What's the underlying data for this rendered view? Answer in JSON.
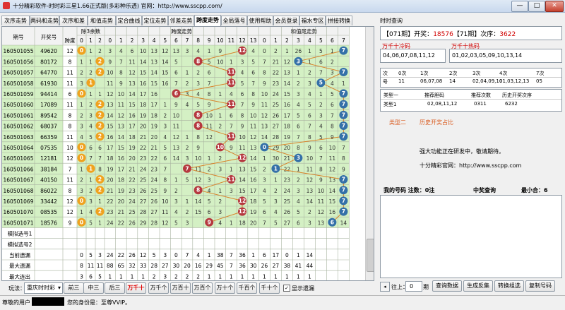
{
  "window": {
    "title": "十分精彩软件-时时彩三星1.66正式版(多彩种乐透) 官网：http://www.sscpp.com/",
    "minimize_label": "—",
    "maximize_label": "□",
    "close_label": "✕"
  },
  "tabs": [
    "次序走势",
    "两码和走势",
    "次序和差",
    "和值走势",
    "定合曲线",
    "定位走势",
    "邻差走势",
    "跨度走势",
    "全局落号",
    "使用帮助",
    "会员登录",
    "福水专区",
    "拼接转换"
  ],
  "active_tab": 7,
  "grid": {
    "header_top": {
      "period": "期号",
      "number": "开奖号",
      "rem3": "除3余数",
      "span": "跨度走势",
      "sum_tail": "和值尾走势"
    },
    "header_span_label": "跨度",
    "rem3_cols": [
      "0",
      "1",
      "2"
    ],
    "span_cols": [
      "0",
      "1",
      "2",
      "3",
      "4",
      "5",
      "6",
      "7",
      "8",
      "9",
      "10",
      "11",
      "12",
      "13"
    ],
    "sumtail_cols": [
      "0",
      "1",
      "2",
      "3",
      "4",
      "5",
      "6",
      "7"
    ],
    "rows": [
      {
        "period": "160501055",
        "number": "49620",
        "span": "12",
        "rem": [
          0,
          1,
          2
        ],
        "spans": [
          3,
          4,
          6,
          10,
          13,
          12,
          13,
          3,
          4,
          1,
          9,
          null,
          2,
          4
        ],
        "tail": [
          0,
          2,
          1,
          26,
          1,
          5,
          1,
          null
        ]
      },
      {
        "period": "160501056",
        "number": "80172",
        "span": "8",
        "rem": [
          1,
          1,
          null
        ],
        "spans": [
          9,
          7,
          11,
          14,
          13,
          14,
          5,
          null,
          1,
          5,
          10,
          1,
          3,
          5
        ],
        "tail": [
          7,
          21,
          12,
          null,
          1,
          6,
          2,
          null
        ]
      },
      {
        "period": "160501057",
        "number": "64770",
        "span": "11",
        "rem": [
          2,
          2,
          null
        ],
        "spans": [
          10,
          8,
          12,
          15,
          14,
          15,
          6,
          1,
          2,
          6,
          null,
          2,
          4,
          6
        ],
        "tail": [
          8,
          22,
          13,
          1,
          2,
          7,
          3,
          null
        ]
      },
      {
        "period": "160501058",
        "number": "61930",
        "span": "11",
        "rem": [
          3,
          3,
          null
        ],
        "spans": [
          11,
          9,
          13,
          16,
          15,
          16,
          7,
          2,
          3,
          7,
          null,
          3,
          5,
          7
        ],
        "tail": [
          9,
          23,
          14,
          2,
          3,
          null,
          4,
          1
        ]
      },
      {
        "period": "160501059",
        "number": "94414",
        "span": "6",
        "rem": [
          null,
          1,
          1
        ],
        "spans": [
          12,
          10,
          14,
          17,
          16,
          null,
          8,
          3,
          4,
          8,
          1,
          4,
          6,
          8
        ],
        "tail": [
          10,
          24,
          15,
          3,
          4,
          1,
          5,
          2
        ]
      },
      {
        "period": "160501060",
        "number": "17089",
        "span": "11",
        "rem": [
          1,
          2,
          2
        ],
        "spans": [
          13,
          11,
          15,
          18,
          17,
          1,
          9,
          4,
          5,
          9,
          null,
          5,
          7,
          9
        ],
        "tail": [
          11,
          25,
          16,
          4,
          5,
          2,
          6,
          3
        ]
      },
      {
        "period": "160501061",
        "number": "89542",
        "span": "8",
        "rem": [
          2,
          3,
          3
        ],
        "spans": [
          14,
          12,
          16,
          19,
          18,
          2,
          10,
          null,
          6,
          10,
          1,
          6,
          8,
          10
        ],
        "tail": [
          12,
          26,
          17,
          5,
          6,
          3,
          7,
          4
        ]
      },
      {
        "period": "160501062",
        "number": "68037",
        "span": "8",
        "rem": [
          3,
          4,
          4
        ],
        "spans": [
          15,
          13,
          17,
          20,
          19,
          3,
          11,
          null,
          7,
          11,
          2,
          7,
          9,
          11
        ],
        "tail": [
          13,
          27,
          18,
          6,
          7,
          4,
          8,
          5
        ]
      },
      {
        "period": "160501063",
        "number": "66359",
        "span": "11",
        "rem": [
          4,
          5,
          5
        ],
        "spans": [
          16,
          14,
          18,
          21,
          20,
          4,
          12,
          1,
          8,
          12,
          null,
          8,
          10,
          12
        ],
        "tail": [
          14,
          28,
          19,
          7,
          8,
          5,
          9,
          6
        ]
      },
      {
        "period": "160501064",
        "number": "07535",
        "span": "10",
        "rem": [
          5,
          6,
          6
        ],
        "spans": [
          17,
          15,
          19,
          22,
          21,
          5,
          13,
          2,
          9,
          null,
          1,
          9,
          11,
          13
        ],
        "tail": [
          null,
          29,
          20,
          8,
          9,
          6,
          10,
          7
        ]
      },
      {
        "period": "160501065",
        "number": "12181",
        "span": "12",
        "rem": [
          0,
          7,
          7
        ],
        "spans": [
          18,
          16,
          20,
          23,
          22,
          6,
          14,
          3,
          10,
          1,
          2,
          null,
          12,
          14
        ],
        "tail": [
          1,
          30,
          21,
          null,
          10,
          7,
          11,
          8
        ]
      },
      {
        "period": "160501066",
        "number": "38184",
        "span": "7",
        "rem": [
          1,
          null,
          8
        ],
        "spans": [
          19,
          17,
          21,
          24,
          23,
          7,
          null,
          4,
          11,
          2,
          3,
          1,
          13,
          15
        ],
        "tail": [
          2,
          null,
          22,
          1,
          11,
          8,
          12,
          9
        ]
      },
      {
        "period": "160501067",
        "number": "40150",
        "span": "11",
        "rem": [
          2,
          1,
          null
        ],
        "spans": [
          20,
          18,
          22,
          25,
          24,
          8,
          1,
          5,
          12,
          3,
          null,
          2,
          14,
          16
        ],
        "tail": [
          3,
          1,
          23,
          2,
          12,
          9,
          13,
          10
        ]
      },
      {
        "period": "160501068",
        "number": "86022",
        "span": "8",
        "rem": [
          3,
          2,
          null
        ],
        "spans": [
          21,
          19,
          23,
          26,
          25,
          9,
          2,
          null,
          13,
          4,
          1,
          3,
          15,
          17
        ],
        "tail": [
          4,
          2,
          24,
          3,
          13,
          10,
          14,
          11
        ]
      },
      {
        "period": "160501069",
        "number": "33442",
        "span": "12",
        "rem": [
          null,
          3,
          1
        ],
        "spans": [
          22,
          20,
          24,
          27,
          26,
          10,
          3,
          1,
          14,
          5,
          2,
          null,
          16,
          18
        ],
        "tail": [
          5,
          3,
          25,
          4,
          14,
          11,
          15,
          12
        ]
      },
      {
        "period": "160501070",
        "number": "08535",
        "span": "12",
        "rem": [
          1,
          4,
          null
        ],
        "spans": [
          23,
          21,
          25,
          28,
          27,
          11,
          4,
          2,
          15,
          6,
          3,
          null,
          17,
          19
        ],
        "tail": [
          6,
          4,
          26,
          5,
          2,
          12,
          16,
          13
        ]
      },
      {
        "period": "160501071",
        "number": "18576",
        "span": "9",
        "rem": [
          null,
          5,
          1
        ],
        "spans": [
          24,
          22,
          26,
          29,
          28,
          12,
          5,
          3,
          null,
          7,
          4,
          1,
          18,
          20
        ],
        "tail": [
          7,
          5,
          27,
          6,
          3,
          13,
          null,
          14
        ]
      }
    ],
    "hit_points": [
      {
        "row": 0,
        "rem": 0,
        "span": 12,
        "tail": 7
      },
      {
        "row": 1,
        "rem": 2,
        "span": 8,
        "tail": 3
      },
      {
        "row": 2,
        "rem": 2,
        "span": 11,
        "tail": 7
      },
      {
        "row": 3,
        "rem": 1,
        "span": 11,
        "tail": 5
      },
      {
        "row": 4,
        "rem": 0,
        "span": 6,
        "tail": 7
      },
      {
        "row": 5,
        "rem": 2,
        "span": 11,
        "tail": 7
      },
      {
        "row": 6,
        "rem": 2,
        "span": 8,
        "tail": 7
      },
      {
        "row": 7,
        "rem": 2,
        "span": 8,
        "tail": 7
      },
      {
        "row": 8,
        "rem": 2,
        "span": 11,
        "tail": 7
      },
      {
        "row": 9,
        "rem": 0,
        "span": 10,
        "tail": 0
      },
      {
        "row": 10,
        "rem": 0,
        "span": 12,
        "tail": 3
      },
      {
        "row": 11,
        "rem": 1,
        "span": 7,
        "tail": 1
      },
      {
        "row": 12,
        "rem": 2,
        "span": 11,
        "tail": 7
      },
      {
        "row": 13,
        "rem": 2,
        "span": 8,
        "tail": 7
      },
      {
        "row": 14,
        "rem": 0,
        "span": 12,
        "tail": 7
      },
      {
        "row": 15,
        "rem": 2,
        "span": 12,
        "tail": 7
      },
      {
        "row": 16,
        "rem": 0,
        "span": 9,
        "tail": 6
      }
    ],
    "footer_rows": [
      {
        "label": "模拟选号1",
        "values": []
      },
      {
        "label": "模拟选号2",
        "values": []
      },
      {
        "label": "当前遗漏",
        "values": [
          "0",
          "5",
          "3",
          "24",
          "22",
          "26",
          "12",
          "5",
          "3",
          "0",
          "7",
          "4",
          "1",
          "38",
          "7",
          "36",
          "1",
          "6",
          "17",
          "0",
          "1",
          "14"
        ]
      },
      {
        "label": "最大遗漏",
        "values": [
          "8",
          "11",
          "11",
          "88",
          "65",
          "32",
          "33",
          "28",
          "27",
          "30",
          "20",
          "16",
          "29",
          "45",
          "7",
          "36",
          "30",
          "26",
          "27",
          "38",
          "41",
          "44"
        ]
      },
      {
        "label": "最大连出",
        "values": [
          "3",
          "6",
          "5",
          "1",
          "1",
          "1",
          "1",
          "2",
          "3",
          "2",
          "2",
          "2",
          "1",
          "1",
          "1",
          "1",
          "1",
          "1",
          "1",
          "1",
          "1",
          "1"
        ]
      }
    ]
  },
  "toolbar": {
    "play_label": "玩法：",
    "play_value": "重庆时时彩",
    "buttons": [
      "前三",
      "中三",
      "后三",
      "万千十",
      "万千个",
      "万百十",
      "万百个",
      "万十个",
      "千百个",
      "千十个"
    ],
    "active_button": 3,
    "show_miss_label": "显示遗漏",
    "show_miss_checked": true
  },
  "statusbar": {
    "user_label": "尊敬的用户",
    "identity_label": "您的身份是：至尊VVIP。"
  },
  "right": {
    "section_title": "时时查询",
    "issue_line": {
      "prefix": "【071期】开奖：",
      "number": "18576",
      "mid": "【71期】次序：",
      "order": "3622"
    },
    "cold_title": "万千十冷码",
    "cold_value": "04,06,07,08,11,12",
    "hot_title": "万千十热码",
    "hot_value": "01,02,03,05,09,10,13,14",
    "order_table": {
      "headers": [
        "次",
        "0次",
        "1次",
        "2次",
        "3次",
        "4次",
        "7次"
      ],
      "values": [
        "号",
        "11",
        "06,07,08",
        "14",
        "02,04,09,10",
        "01,03,12,13",
        "05"
      ]
    },
    "type_table": {
      "headers": [
        "类型一",
        "推荐胆码",
        "推荐次数",
        "历史开奖次序"
      ],
      "row": [
        "类型1",
        "02,08,11,12",
        "0311",
        "6232"
      ]
    },
    "type2_label": "类型二",
    "history_label": "历史开奖占比",
    "notice1": "强大功能正在研发中，敬请期待。",
    "notice2": "十分精彩官网：http://www.sscpp.com",
    "my_number_label": "我的号码 注数：0注",
    "prize_label": "中奖查询",
    "min_label": "最小合：6",
    "up_label": "往上：",
    "up_value": "0",
    "period_unit": "期",
    "buttons": [
      "查询数据",
      "生成反集",
      "转换组选",
      "复制号码"
    ]
  },
  "colors": {
    "green_bg": "#d4f0c4",
    "highlight_row": "#ffffff",
    "orange_ball": "#f0a21e",
    "red_ball": "#b5383f",
    "blue_ball": "#3470a8",
    "line": "#d9832a",
    "accent_red": "#d00000"
  }
}
